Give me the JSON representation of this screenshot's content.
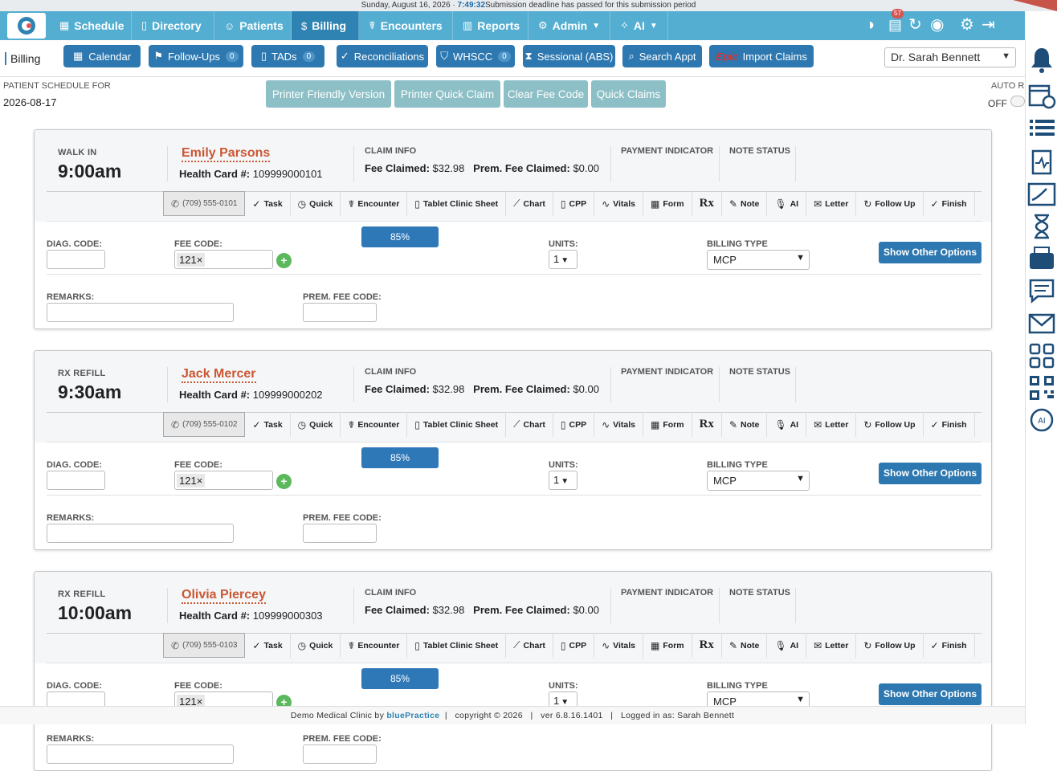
{
  "top_strip": {
    "date": "Sunday, August 16, 2026 · ",
    "clock": "7:49:32",
    "message": "Submission deadline has passed for this submission period"
  },
  "navbar": {
    "items": [
      {
        "label": "Schedule",
        "icon": "calendar-icon"
      },
      {
        "label": "Directory",
        "icon": "book-icon"
      },
      {
        "label": "Patients",
        "icon": "users-icon"
      },
      {
        "label": "Billing",
        "icon": "dollar-icon",
        "active": true
      },
      {
        "label": "Encounters",
        "icon": "stethoscope-icon"
      },
      {
        "label": "Reports",
        "icon": "bar-chart-icon"
      },
      {
        "label": "Admin",
        "icon": "gear-icon"
      },
      {
        "label": "AI",
        "icon": "sparkle-icon"
      }
    ],
    "notif_count": "57"
  },
  "subbar": {
    "title": "Billing",
    "buttons": [
      {
        "label": "Calendar",
        "icon": "calendar-icon"
      },
      {
        "label": "Follow-Ups",
        "count": "0",
        "icon": "flag-icon"
      },
      {
        "label": "TADs",
        "count": "0",
        "icon": "file-icon"
      },
      {
        "label": "Reconciliations",
        "icon": "check-circle-icon"
      },
      {
        "label": "WHSCC",
        "count": "0",
        "icon": "shield-icon"
      },
      {
        "label": "Sessional (ABS)",
        "icon": "hourglass-icon"
      },
      {
        "label": "Search Appt",
        "icon": "search-icon"
      },
      {
        "label": "Import Claims",
        "brand": "Epic"
      }
    ],
    "doctor": "Dr. Sarah Bennett"
  },
  "schedule": {
    "label": "PATIENT SCHEDULE FOR",
    "date": "2026-08-17"
  },
  "actions": [
    "Printer Friendly Version",
    "Printer Quick Claim",
    "Clear Fee Code",
    "Quick Claims"
  ],
  "auto_refresh": {
    "label": "AUTO RI",
    "state": "OFF"
  },
  "labels": {
    "health_card": "Health Card #:",
    "claim_info": "CLAIM INFO",
    "fee_claimed": "Fee Claimed:",
    "prem_fee_claimed": "Prem. Fee Claimed:",
    "payment_indicator": "PAYMENT INDICATOR",
    "note_status": "NOTE STATUS",
    "diag_code": "DIAG. CODE:",
    "fee_code": "FEE CODE:",
    "units": "UNITS:",
    "billing_type": "BILLING TYPE",
    "remarks": "REMARKS:",
    "prem_fee_code": "PREM. FEE CODE:",
    "show_other": "Show Other Options"
  },
  "tools": [
    "Task",
    "Quick",
    "Encounter",
    "Tablet Clinic Sheet",
    "Chart",
    "CPP",
    "Vitals",
    "Form",
    "Rx",
    "Note",
    "AI",
    "Letter",
    "Follow Up",
    "Finish"
  ],
  "appointments": [
    {
      "visit_type": "WALK IN",
      "time": "9:00am",
      "name": "Emily Parsons",
      "health_card": "109999000101",
      "fee_claimed": "$32.98",
      "prem_fee_claimed": "$0.00",
      "phone": "(709) 555-0101",
      "fee_code": "121×",
      "progress": "85%",
      "units": "1",
      "billing_type": "MCP"
    },
    {
      "visit_type": "RX REFILL",
      "time": "9:30am",
      "name": "Jack Mercer",
      "health_card": "109999000202",
      "fee_claimed": "$32.98",
      "prem_fee_claimed": "$0.00",
      "phone": "(709) 555-0102",
      "fee_code": "121×",
      "progress": "85%",
      "units": "1",
      "billing_type": "MCP"
    },
    {
      "visit_type": "RX REFILL",
      "time": "10:00am",
      "name": "Olivia Piercey",
      "health_card": "109999000303",
      "fee_claimed": "$32.98",
      "prem_fee_claimed": "$0.00",
      "phone": "(709) 555-0103",
      "fee_code": "121×",
      "progress": "85%",
      "units": "1",
      "billing_type": "MCP"
    }
  ],
  "footer": {
    "clinic": "Demo Medical Clinic by ",
    "brand": "bluePractice",
    "rest": "  |   copyright © 2026   |   ver 6.8.16.1401   |   Logged in as: Sarah Bennett"
  }
}
